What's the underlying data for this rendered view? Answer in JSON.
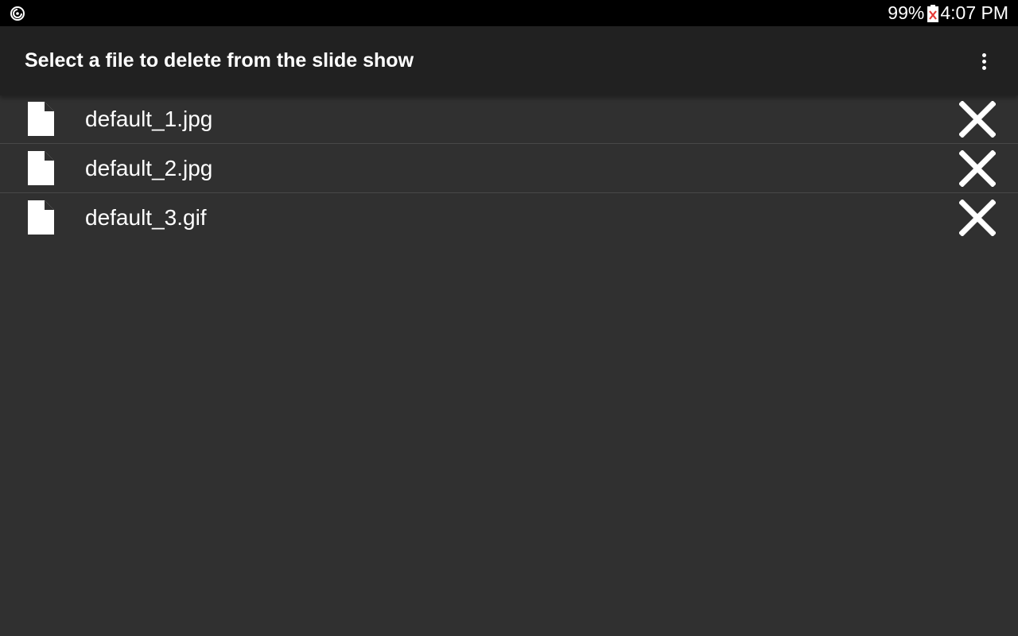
{
  "status_bar": {
    "battery_percent": "99%",
    "time": "4:07 PM",
    "left_icon": "sync-circle-icon",
    "battery_icon": "battery-alert-icon"
  },
  "toolbar": {
    "title": "Select a file to delete from the slide show",
    "menu_icon": "more-vertical-icon"
  },
  "files": [
    {
      "name": "default_1.jpg",
      "icon": "file-icon",
      "action_icon": "close-icon"
    },
    {
      "name": "default_2.jpg",
      "icon": "file-icon",
      "action_icon": "close-icon"
    },
    {
      "name": "default_3.gif",
      "icon": "file-icon",
      "action_icon": "close-icon"
    }
  ],
  "colors": {
    "status_bar_bg": "#000000",
    "toolbar_bg": "#212121",
    "content_bg": "#303030",
    "divider": "#484848",
    "text": "#ffffff",
    "battery_alert": "#e53935"
  }
}
